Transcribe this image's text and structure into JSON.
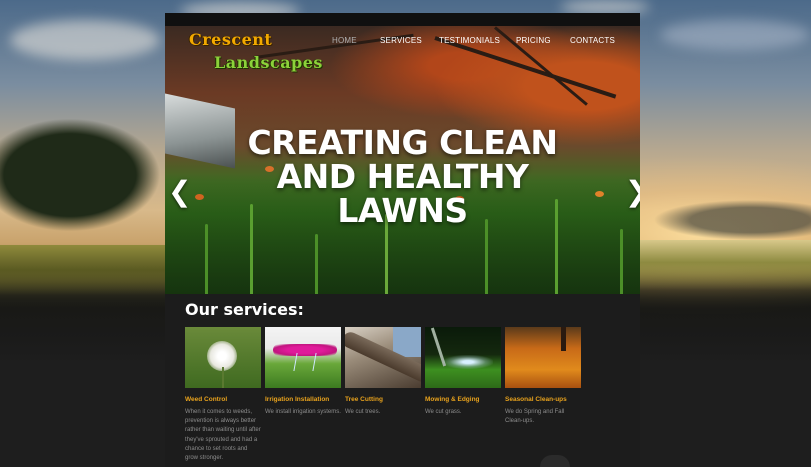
{
  "brand": {
    "line1": "Crescent",
    "line2": "Landscapes"
  },
  "nav": {
    "items": [
      {
        "label": "HOME",
        "active": true
      },
      {
        "label": "SERVICES",
        "active": false
      },
      {
        "label": "TESTIMONIALS",
        "active": false
      },
      {
        "label": "PRICING",
        "active": false
      },
      {
        "label": "CONTACTS",
        "active": false
      }
    ]
  },
  "hero": {
    "title_lines": [
      "CREATING CLEAN",
      "AND HEALTHY",
      "LAWNS"
    ],
    "prev_arrow": "❮",
    "next_arrow": "❯"
  },
  "services": {
    "heading": "Our services:",
    "items": [
      {
        "name": "Weed Control",
        "description": "When it comes to weeds, prevention is always better rather than waiting until after they've sprouted and had a chance to set roots and grow stronger."
      },
      {
        "name": "Irrigation Installation",
        "description": "We install irrigation systems."
      },
      {
        "name": "Tree Cutting",
        "description": "We cut trees."
      },
      {
        "name": "Mowing & Edging",
        "description": "We cut grass."
      },
      {
        "name": "Seasonal Clean-ups",
        "description": "We do Spring and Fall Clean-ups."
      }
    ]
  },
  "colors": {
    "accent_orange": "#e8a21c",
    "logo_orange": "#f2a900",
    "logo_green": "#8cd13a",
    "page_dark": "#1c1c1c"
  }
}
